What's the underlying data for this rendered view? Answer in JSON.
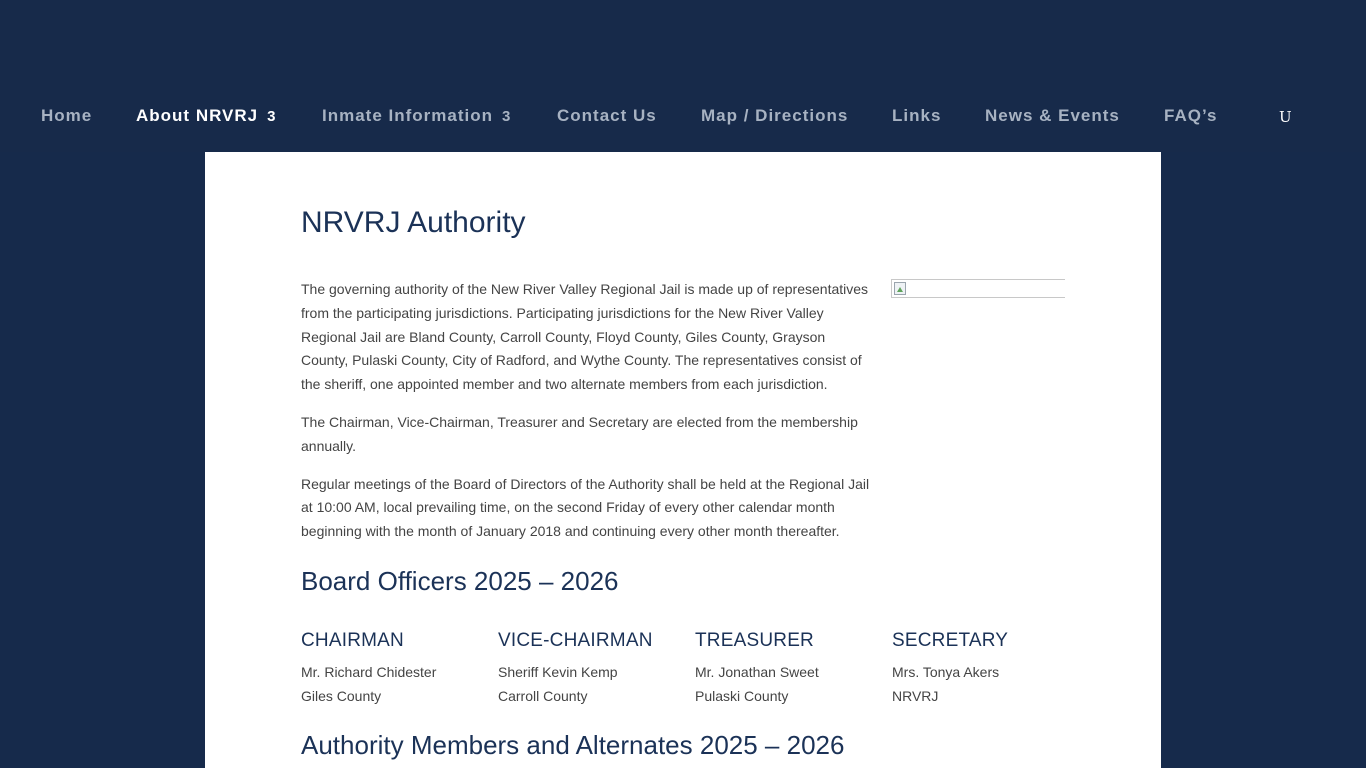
{
  "nav": {
    "items": [
      {
        "label": "Home",
        "has_submenu": false
      },
      {
        "label": "About NRVRJ",
        "has_submenu": true,
        "active": true
      },
      {
        "label": "Inmate Information",
        "has_submenu": true
      },
      {
        "label": "Contact Us",
        "has_submenu": false
      },
      {
        "label": "Map / Directions",
        "has_submenu": false
      },
      {
        "label": "Links",
        "has_submenu": false
      },
      {
        "label": "News & Events",
        "has_submenu": false
      },
      {
        "label": "FAQ’s",
        "has_submenu": false
      }
    ],
    "submenu_glyph": "3",
    "search_glyph": "U"
  },
  "page": {
    "title": "NRVRJ Authority",
    "paragraphs": [
      "The governing authority of the New River Valley Regional Jail is made up of representatives from the participating jurisdictions. Participating jurisdictions for the New River Valley Regional Jail are Bland County, Carroll County, Floyd County, Giles County, Grayson County, Pulaski County, City of Radford, and Wythe County. The representatives consist of the sheriff, one appointed member and two alternate members from each jurisdiction.",
      "The Chairman, Vice-Chairman, Treasurer and Secretary are elected from the membership annually.",
      "Regular meetings of the Board of Directors of the Authority shall be held at the Regional Jail at 10:00 AM, local prevailing time, on the second Friday of every other calendar month beginning with the month of January 2018 and continuing every other month thereafter."
    ],
    "board_title": "Board Officers 2025 – 2026",
    "officers": [
      {
        "role": "CHAIRMAN",
        "name": "Mr. Richard Chidester",
        "jurisdiction": "Giles County"
      },
      {
        "role": "VICE-CHAIRMAN",
        "name": "Sheriff Kevin Kemp",
        "jurisdiction": "Carroll County"
      },
      {
        "role": "TREASURER",
        "name": "Mr. Jonathan Sweet",
        "jurisdiction": "Pulaski County"
      },
      {
        "role": "SECRETARY",
        "name": "Mrs. Tonya Akers",
        "jurisdiction": "NRVRJ"
      }
    ],
    "members_title": "Authority Members and Alternates 2025 – 2026"
  },
  "colors": {
    "background": "#162a4b",
    "header": "#172a4a",
    "nav_text": "#a7b2c2",
    "nav_active": "#ffffff",
    "heading": "#1b3257",
    "body_text": "#444444"
  }
}
